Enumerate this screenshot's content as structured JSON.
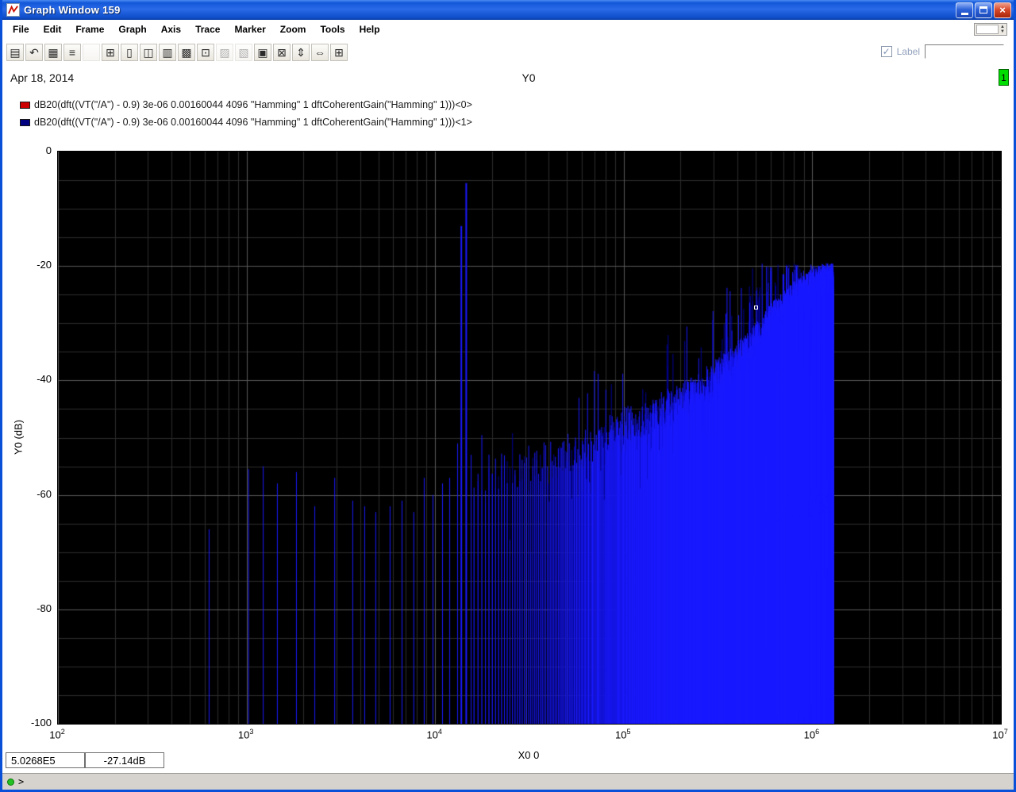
{
  "window": {
    "title": "Graph Window 159"
  },
  "menu": {
    "items": [
      "File",
      "Edit",
      "Frame",
      "Graph",
      "Axis",
      "Trace",
      "Marker",
      "Zoom",
      "Tools",
      "Help"
    ]
  },
  "toolbar": {
    "label_checkbox_text": "Label",
    "label_checkbox_checked": true,
    "check_glyph": "✓",
    "label_field_value": "",
    "icons": [
      {
        "name": "printer-icon",
        "glyph": "▤",
        "disabled": false
      },
      {
        "name": "undo-icon",
        "glyph": "↶",
        "disabled": false
      },
      {
        "name": "comb-grid-icon",
        "glyph": "▦",
        "disabled": false
      },
      {
        "name": "doc-lines-icon",
        "glyph": "≡",
        "disabled": false
      },
      {
        "name": "blank-icon",
        "glyph": "",
        "disabled": true
      },
      {
        "name": "add-subwindow-icon",
        "glyph": "⊞",
        "disabled": false
      },
      {
        "name": "page-icon",
        "glyph": "▯",
        "disabled": false
      },
      {
        "name": "copy-graph-icon",
        "glyph": "◫",
        "disabled": false
      },
      {
        "name": "strip-mode-icon",
        "glyph": "▥",
        "disabled": false
      },
      {
        "name": "overlay-mode-icon",
        "glyph": "▩",
        "disabled": false
      },
      {
        "name": "snapshot-icon",
        "glyph": "⊡",
        "disabled": false
      },
      {
        "name": "image-mode-icon",
        "glyph": "▨",
        "disabled": true
      },
      {
        "name": "hatch-mode-icon",
        "glyph": "▧",
        "disabled": true
      },
      {
        "name": "notes-icon",
        "glyph": "▣",
        "disabled": false
      },
      {
        "name": "delete-trace-icon",
        "glyph": "⊠",
        "disabled": false
      },
      {
        "name": "fit-vertical-icon",
        "glyph": "⇕",
        "disabled": false
      },
      {
        "name": "fit-horizontal-icon",
        "glyph": "⇔",
        "disabled": false
      },
      {
        "name": "zoom-region-icon",
        "glyph": "⊞",
        "disabled": false
      }
    ]
  },
  "header": {
    "date": "Apr 18, 2014",
    "center_title": "Y0",
    "page_badge": "1",
    "badge_color": "#00dd00"
  },
  "axes": {
    "ylabel": "Y0 (dB)",
    "xlabel": "X0 0",
    "yticks": [
      "0",
      "-20",
      "-40",
      "-60",
      "-80",
      "-100"
    ],
    "xtick_base": "10",
    "xtick_exponents": [
      2,
      3,
      4,
      5,
      6,
      7
    ]
  },
  "readouts": {
    "x_value": "5.0268E5",
    "y_value": "-27.14dB"
  },
  "statusbar": {
    "prompt": ">",
    "input_value": ""
  },
  "chart_data": {
    "type": "line",
    "title": "Y0",
    "subtitle_date": "Apr 18, 2014",
    "xlabel": "X0 0",
    "ylabel": "Y0 (dB)",
    "x_scale": "log",
    "xlim": [
      100,
      10000000
    ],
    "ylim": [
      -100,
      0
    ],
    "y_major_step": 20,
    "y_minor_step": 5,
    "grid": true,
    "legend_position": "top-left",
    "plot_bg": "#000000",
    "grid_color_major": "#5a5a5a",
    "grid_color_minor": "#2c2c2c",
    "trace_draw_colors": [
      "#000099",
      "#1a1aff"
    ],
    "series": [
      {
        "name": "dB20(dft((VT(\"/A\") - 0.9) 3e-06 0.00160044 4096 \"Hamming\" 1 dftCoherentGain(\"Hamming\" 1)))<0>",
        "color": "#cc0000"
      },
      {
        "name": "dB20(dft((VT(\"/A\") - 0.9) 3e-06 0.00160044 4096 \"Hamming\" 1 dftCoherentGain(\"Hamming\" 1)))<1>",
        "color": "#000080"
      }
    ],
    "spikes": [
      [
        630,
        -66
      ],
      [
        1020,
        -55.5
      ],
      [
        1220,
        -55
      ],
      [
        1450,
        -58
      ],
      [
        1830,
        -56
      ],
      [
        2290,
        -62
      ],
      [
        2920,
        -57
      ],
      [
        3640,
        -61
      ],
      [
        4210,
        -62
      ],
      [
        4820,
        -63
      ],
      [
        5740,
        -62
      ],
      [
        6640,
        -61
      ],
      [
        7670,
        -63
      ],
      [
        8710,
        -57
      ],
      [
        9690,
        -60
      ],
      [
        10890,
        -58
      ],
      [
        11890,
        -57
      ],
      [
        13090,
        -51
      ],
      [
        13700,
        -13
      ],
      [
        14550,
        -5.5
      ],
      [
        15440,
        -53
      ]
    ],
    "noise_band": {
      "f0": 800,
      "f_start": 16000,
      "f_end": 1290000,
      "envelope": [
        [
          16000,
          -57
        ],
        [
          30000,
          -55
        ],
        [
          60000,
          -52
        ],
        [
          100000,
          -48
        ],
        [
          200000,
          -44
        ],
        [
          300000,
          -40
        ],
        [
          450000,
          -35
        ],
        [
          600000,
          -30
        ],
        [
          800000,
          -26
        ],
        [
          1000000,
          -24
        ],
        [
          1290000,
          -22
        ]
      ],
      "jitter_db": 3.5,
      "tall_spike_prob": 0.045,
      "tall_spike_extra_db": 9,
      "floor_db": -100,
      "top_clamp_db": -19.5
    },
    "marker": {
      "x": 502680,
      "y_db": -27.14,
      "x_readout": "5.0268E5",
      "y_readout": "-27.14dB"
    }
  }
}
